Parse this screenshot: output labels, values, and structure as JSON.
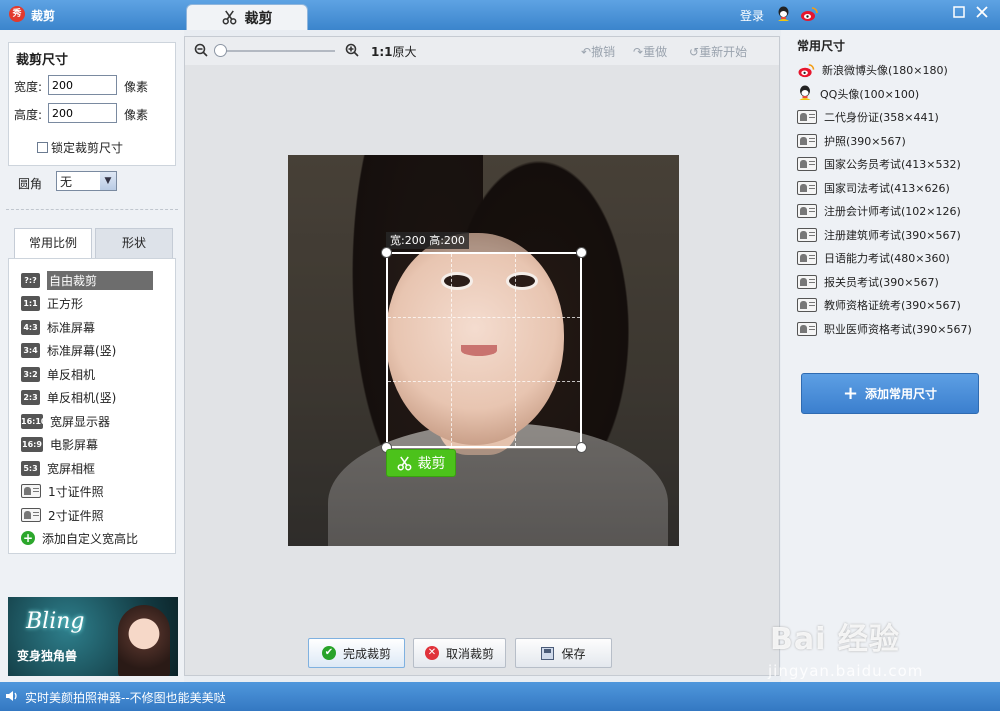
{
  "app": {
    "title": "裁剪",
    "tab_label": "裁剪",
    "login": "登录"
  },
  "crop_size": {
    "title": "裁剪尺寸",
    "width_label": "宽度:",
    "width_value": "200",
    "width_unit": "像素",
    "height_label": "高度:",
    "height_value": "200",
    "height_unit": "像素",
    "lock_label": "锁定裁剪尺寸",
    "corner_label": "圆角",
    "corner_value": "无"
  },
  "ratio_tabs": [
    "常用比例",
    "形状"
  ],
  "ratios": [
    {
      "badge": "?:?",
      "label": "自由裁剪",
      "selected": true
    },
    {
      "badge": "1:1",
      "label": "正方形"
    },
    {
      "badge": "4:3",
      "label": "标准屏幕"
    },
    {
      "badge": "3:4",
      "label": "标准屏幕(竖)"
    },
    {
      "badge": "3:2",
      "label": "单反相机"
    },
    {
      "badge": "2:3",
      "label": "单反相机(竖)"
    },
    {
      "badge": "16:10",
      "label": "宽屏显示器"
    },
    {
      "badge": "16:9",
      "label": "电影屏幕"
    },
    {
      "badge": "5:3",
      "label": "宽屏相框"
    },
    {
      "badge": "",
      "label": "1寸证件照"
    },
    {
      "badge": "",
      "label": "2寸证件照"
    },
    {
      "badge": "",
      "label": "添加自定义宽高比"
    }
  ],
  "banner": {
    "script": "Bling",
    "caption": "变身独角兽"
  },
  "toolbar": {
    "zoom_ratio_bold": "1:1",
    "zoom_ratio_text": "原大",
    "undo": "撤销",
    "redo": "重做",
    "restart": "重新开始",
    "zoom_level": 0
  },
  "crop": {
    "size_tag": "宽:200 高:200",
    "apply_label": "裁剪"
  },
  "footer": {
    "finish": "完成裁剪",
    "cancel": "取消裁剪",
    "save": "保存"
  },
  "presets": {
    "title": "常用尺寸",
    "items": [
      {
        "icon": "weibo-icon",
        "label": "新浪微博头像(180×180)"
      },
      {
        "icon": "qq-icon",
        "label": "QQ头像(100×100)"
      },
      {
        "icon": "id-photo-icon",
        "label": "二代身份证(358×441)"
      },
      {
        "icon": "id-photo-icon",
        "label": "护照(390×567)"
      },
      {
        "icon": "id-photo-icon",
        "label": "国家公务员考试(413×532)"
      },
      {
        "icon": "id-photo-icon",
        "label": "国家司法考试(413×626)"
      },
      {
        "icon": "id-photo-icon",
        "label": "注册会计师考试(102×126)"
      },
      {
        "icon": "id-photo-icon",
        "label": "注册建筑师考试(390×567)"
      },
      {
        "icon": "id-photo-icon",
        "label": "日语能力考试(480×360)"
      },
      {
        "icon": "id-photo-icon",
        "label": "报关员考试(390×567)"
      },
      {
        "icon": "id-photo-icon",
        "label": "教师资格证统考(390×567)"
      },
      {
        "icon": "id-photo-icon",
        "label": "职业医师资格考试(390×567)"
      }
    ],
    "add_button": "添加常用尺寸"
  },
  "watermark": {
    "main": "Bai 经验",
    "sub": "jingyan.baidu.com"
  },
  "status": {
    "text": "实时美颜拍照神器--不修图也能美美哒"
  },
  "colors": {
    "accent": "#3b85cc",
    "apply_green": "#4cc21b"
  }
}
